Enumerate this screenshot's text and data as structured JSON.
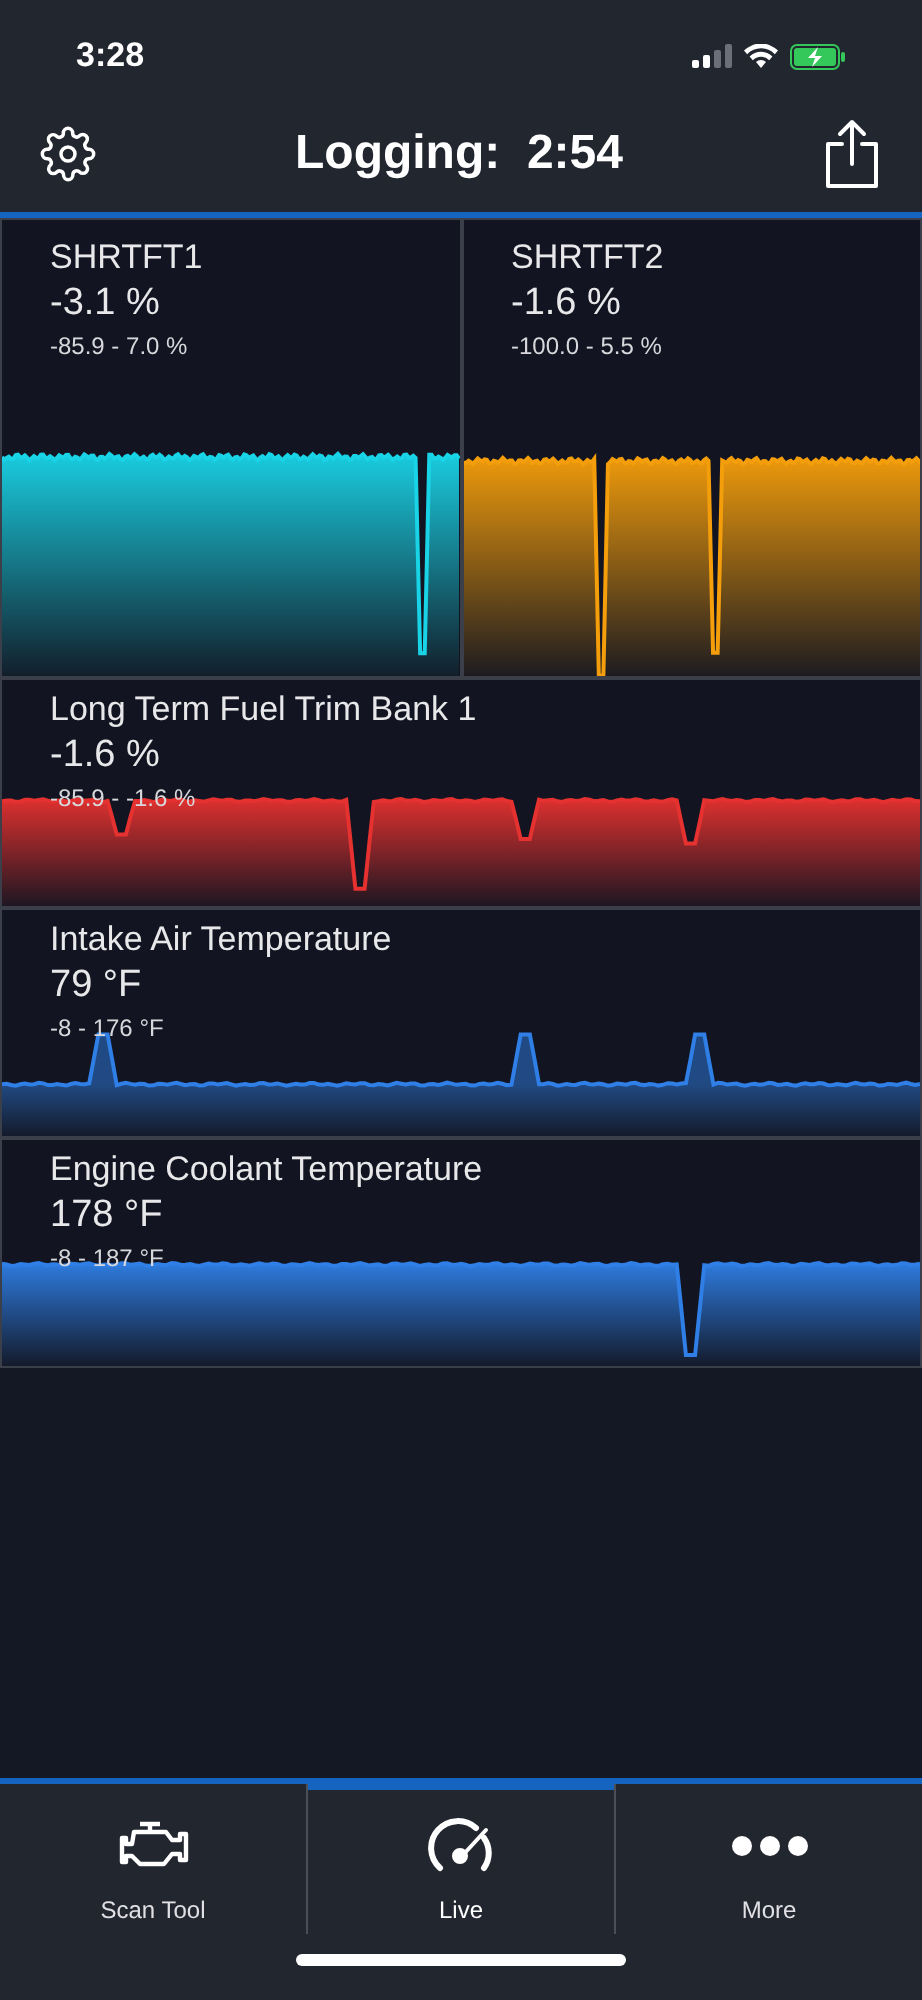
{
  "status_bar": {
    "time": "3:28"
  },
  "header": {
    "title": "Logging:  2:54"
  },
  "gauges": [
    {
      "kind": "half",
      "name": "SHRTFT1",
      "value": "-3.1 %",
      "range": "-85.9 - 7.0 %",
      "color": "#19d3e6"
    },
    {
      "kind": "half",
      "name": "SHRTFT2",
      "value": "-1.6 %",
      "range": "-100.0 - 5.5 %",
      "color": "#f59e0b"
    },
    {
      "kind": "full",
      "name": "Long Term Fuel Trim Bank 1",
      "value": "-1.6 %",
      "range": "-85.9 - -1.6 %",
      "color": "#e5312f"
    },
    {
      "kind": "full",
      "name": "Intake Air Temperature",
      "value": "79 °F",
      "range": "-8 - 176 °F",
      "color": "#2f7fe6"
    },
    {
      "kind": "full",
      "name": "Engine Coolant Temperature",
      "value": "178 °F",
      "range": "-8 - 187 °F",
      "color": "#2f7fe6"
    }
  ],
  "tabs": [
    {
      "kind": "engine",
      "label": "Scan Tool",
      "selected": false
    },
    {
      "kind": "gauge",
      "label": "Live",
      "selected": true
    },
    {
      "kind": "more",
      "label": "More",
      "selected": false
    }
  ]
}
